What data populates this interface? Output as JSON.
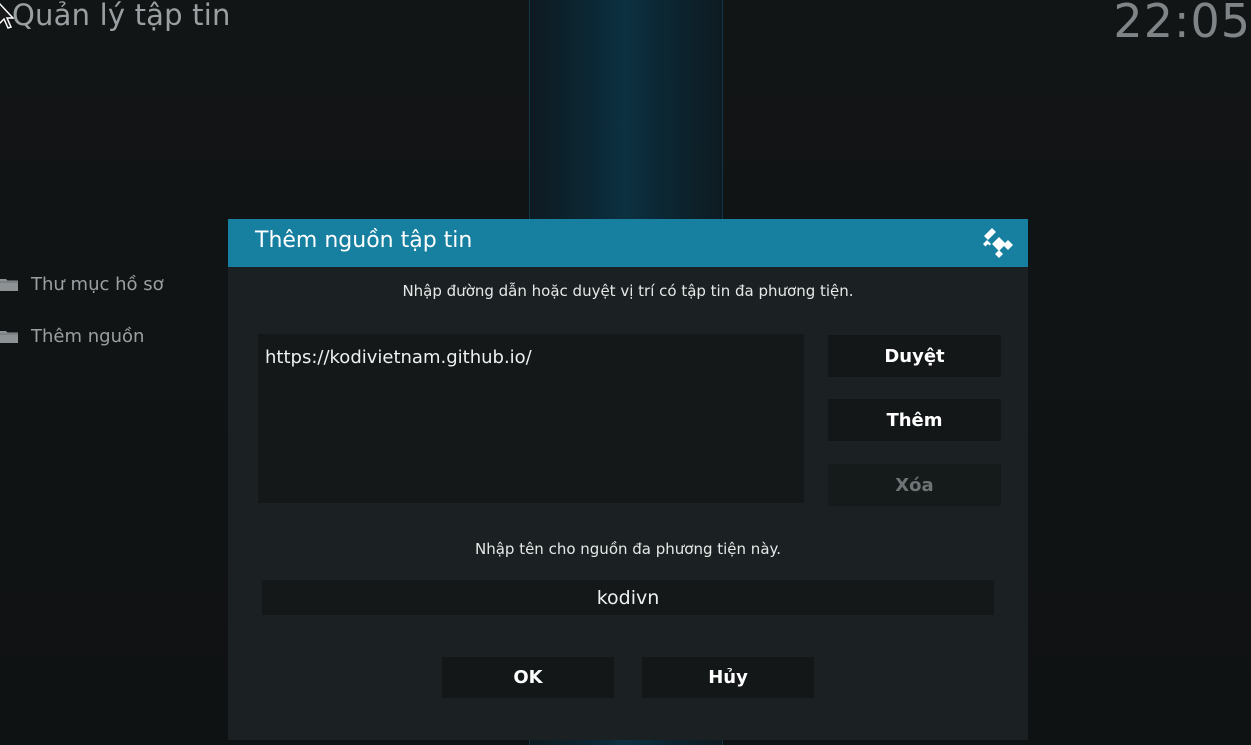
{
  "header": {
    "title": "Quản lý tập tin",
    "clock": "22:05"
  },
  "sidebar": {
    "items": [
      {
        "label": "Thư mục hồ sơ",
        "icon": "folder-icon"
      },
      {
        "label": "Thêm nguồn",
        "icon": "folder-icon"
      }
    ]
  },
  "dialog": {
    "title": "Thêm nguồn tập tin",
    "logo": "kodi-logo-icon",
    "path_hint": "Nhập đường dẫn hoặc duyệt vị trí có tập tin đa phương tiện.",
    "path_value": "https://kodivietnam.github.io/",
    "buttons": {
      "browse": "Duyệt",
      "add": "Thêm",
      "remove": "Xóa"
    },
    "name_hint": "Nhập tên cho nguồn đa phương tiện này.",
    "name_value": "kodivn",
    "ok": "OK",
    "cancel": "Hủy"
  },
  "colors": {
    "accent": "#177fa0",
    "dialog_bg": "#1b2122",
    "field_bg": "#141819",
    "disabled_text": "#6e7475"
  }
}
